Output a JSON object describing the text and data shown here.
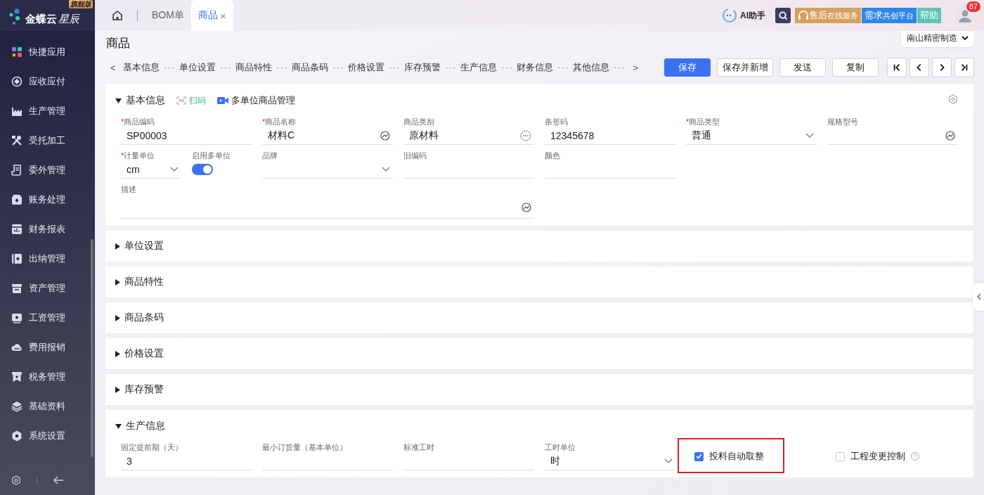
{
  "sidebar": {
    "brand": "金蝶云",
    "brand_script": "星辰",
    "edition": "旗舰版",
    "items": [
      {
        "label": "快捷应用",
        "kind": "apps"
      },
      {
        "label": "应收应付",
        "kind": "cycle"
      },
      {
        "label": "生产管理",
        "kind": "factory"
      },
      {
        "label": "受托加工",
        "kind": "tools"
      },
      {
        "label": "委外管理",
        "kind": "document"
      },
      {
        "label": "账务处理",
        "kind": "box"
      },
      {
        "label": "财务报表",
        "kind": "chart"
      },
      {
        "label": "出纳管理",
        "kind": "wallet"
      },
      {
        "label": "资产管理",
        "kind": "archive"
      },
      {
        "label": "工资管理",
        "kind": "monitor"
      },
      {
        "label": "费用报销",
        "kind": "cloud"
      },
      {
        "label": "税务管理",
        "kind": "receipt"
      },
      {
        "label": "基础资料",
        "kind": "layers"
      },
      {
        "label": "系统设置",
        "kind": "hexagon"
      }
    ]
  },
  "tabs": [
    {
      "label": "BOM单",
      "selected": false
    },
    {
      "label": "商品",
      "selected": true,
      "close": "×"
    }
  ],
  "required_mark": "*",
  "assistant": "AI助手",
  "services": [
    {
      "label": "售后",
      "sub": "在线服务",
      "color": "#d4a15f",
      "kind": "headset"
    },
    {
      "label": "需求",
      "sub": "共创平台",
      "color": "#2f86e8",
      "kind": "plain"
    },
    {
      "label": "帮助",
      "color": "#5cc6b5",
      "kind": "plain"
    }
  ],
  "notifications": "87",
  "page_title": "商品",
  "organization": "南山精密制造",
  "anchor_nav": {
    "prev": "<",
    "next": ">",
    "items": [
      "基本信息",
      "单位设置",
      "商品特性",
      "商品条码",
      "价格设置",
      "库存预警",
      "生产信息",
      "财务信息",
      "其他信息"
    ]
  },
  "buttons": [
    {
      "label": "保存",
      "primary": true
    },
    {
      "label": "保存并新增",
      "primary": false
    },
    {
      "label": "发送",
      "primary": false
    },
    {
      "label": "复制",
      "primary": false
    }
  ],
  "sections": [
    {
      "title": "基本信息",
      "expanded": true,
      "actions": [
        {
          "label": "扫码",
          "kind": "scan"
        },
        {
          "label": "多单位商品管理",
          "kind": "video"
        }
      ],
      "rows": [
        [
          {
            "label": "商品编码",
            "required": true,
            "kind": "text",
            "value": "SP00003"
          },
          {
            "label": "商品名称",
            "required": true,
            "kind": "multilang",
            "value": "材料C"
          },
          {
            "label": "商品类别",
            "required": false,
            "kind": "lookup",
            "value": "原材料"
          },
          {
            "label": "条形码",
            "required": false,
            "kind": "text",
            "value": "12345678"
          },
          {
            "label": "商品类型",
            "required": true,
            "kind": "select",
            "value": "普通"
          },
          {
            "label": "规格型号",
            "required": false,
            "kind": "multilang"
          }
        ],
        [
          {
            "kind": "group",
            "fields": [
              {
                "label": "计量单位",
                "required": true,
                "kind": "select",
                "value": "cm"
              },
              {
                "label": "启用多单位",
                "kind": "toggle",
                "on": true
              }
            ]
          },
          {
            "label": "品牌",
            "required": false,
            "kind": "select"
          },
          {
            "label": "旧编码",
            "required": false,
            "kind": "text"
          },
          {
            "label": "颜色",
            "required": false,
            "kind": "text"
          }
        ],
        [
          {
            "label": "描述",
            "required": false,
            "kind": "textarea"
          }
        ]
      ]
    },
    {
      "title": "单位设置",
      "expanded": false
    },
    {
      "title": "商品特性",
      "expanded": false
    },
    {
      "title": "商品条码",
      "expanded": false
    },
    {
      "title": "价格设置",
      "expanded": false
    },
    {
      "title": "库存预警",
      "expanded": false
    },
    {
      "title": "生产信息",
      "expanded": true,
      "rows": [
        [
          {
            "label": "固定提前期（天）",
            "required": false,
            "kind": "text",
            "value": "3"
          },
          {
            "label": "最小订货量（基本单位）",
            "required": false,
            "kind": "text"
          },
          {
            "label": "标准工时",
            "required": false,
            "kind": "text"
          },
          {
            "label": "工时单位",
            "required": false,
            "kind": "select",
            "value": "时"
          },
          {
            "label": "投料自动取整",
            "kind": "checkbox",
            "checked": true,
            "highlighted": true
          },
          {
            "label": "工程变更控制",
            "kind": "checkbox",
            "checked": false,
            "help": true
          }
        ]
      ]
    }
  ]
}
